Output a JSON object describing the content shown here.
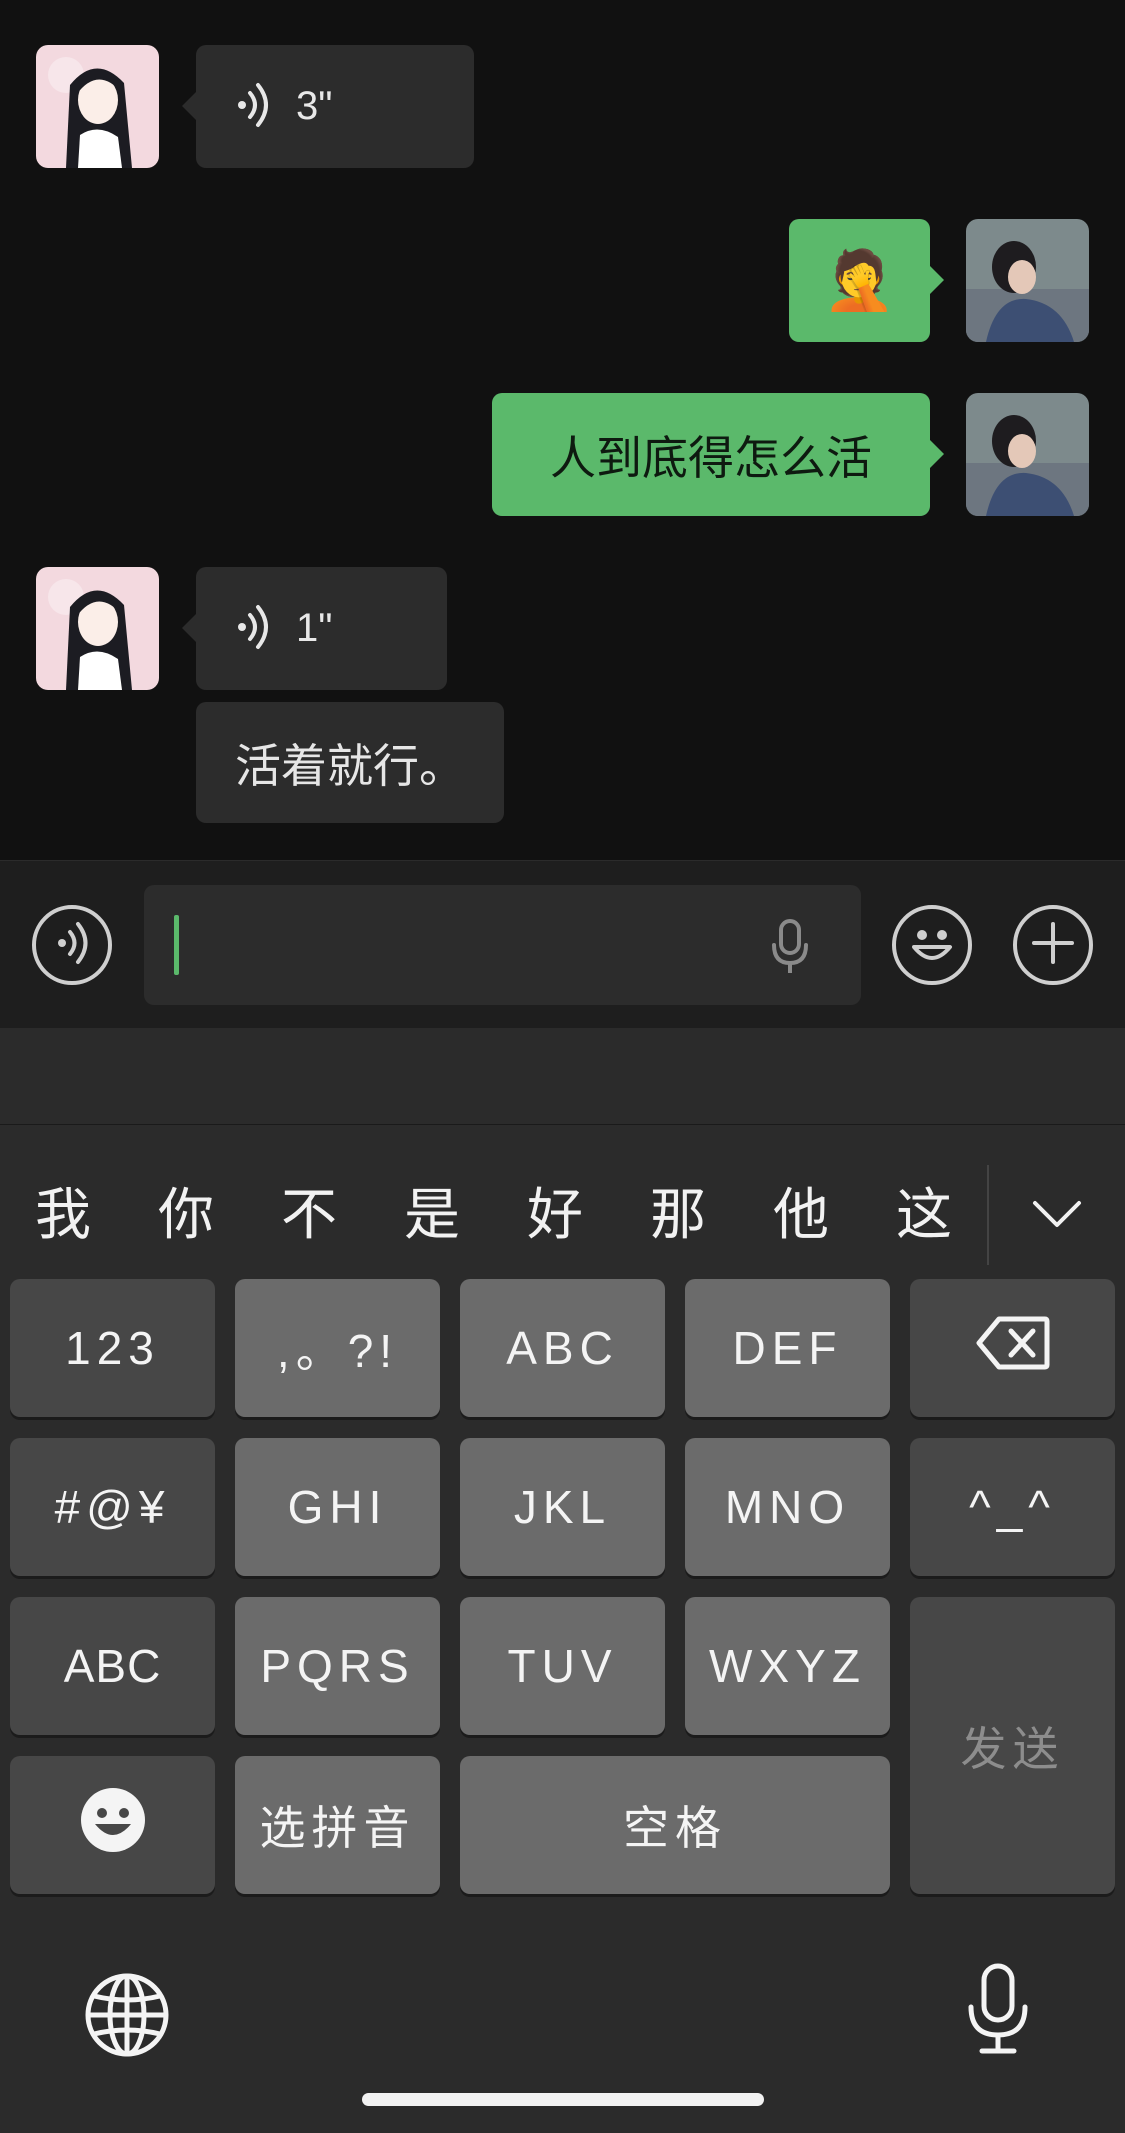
{
  "messages": [
    {
      "id": "m1",
      "side": "in",
      "type": "voice",
      "duration": "3\""
    },
    {
      "id": "m2",
      "side": "out",
      "type": "emoji",
      "emoji": "🤦"
    },
    {
      "id": "m3",
      "side": "out",
      "type": "text",
      "text": "人到底得怎么活"
    },
    {
      "id": "m4",
      "side": "in",
      "type": "voice",
      "duration": "1\""
    },
    {
      "id": "m5",
      "side": "in",
      "type": "text",
      "text": "活着就行。"
    }
  ],
  "input": {
    "value": "",
    "placeholder": ""
  },
  "icons": {
    "voice_toggle": "voice-icon",
    "dictation": "mic-icon",
    "emoji": "smiley-icon",
    "more": "plus-icon",
    "globe": "globe-icon",
    "keyboard_mic": "mic-icon"
  },
  "keyboard": {
    "candidates": [
      "我",
      "你",
      "不",
      "是",
      "好",
      "那",
      "他",
      "这"
    ],
    "keys": {
      "num": "123",
      "punct": ",。?!",
      "abc": "ABC",
      "def": "DEF",
      "sym": "#@¥",
      "ghi": "GHI",
      "jkl": "JKL",
      "mno": "MNO",
      "kaomoji": "^_^",
      "abc_switch": "ABC",
      "pqrs": "PQRS",
      "tuv": "TUV",
      "wxyz": "WXYZ",
      "send": "发送",
      "pinyin": "选拼音",
      "space": "空格"
    }
  },
  "colors": {
    "background": "#111111",
    "incoming_bubble": "#2c2c2c",
    "outgoing_bubble": "#5bb96b",
    "caret": "#5bb96b",
    "keyboard_bg": "#2b2b2b",
    "key_light": "#6b6b6b",
    "key_dark": "#474747"
  }
}
